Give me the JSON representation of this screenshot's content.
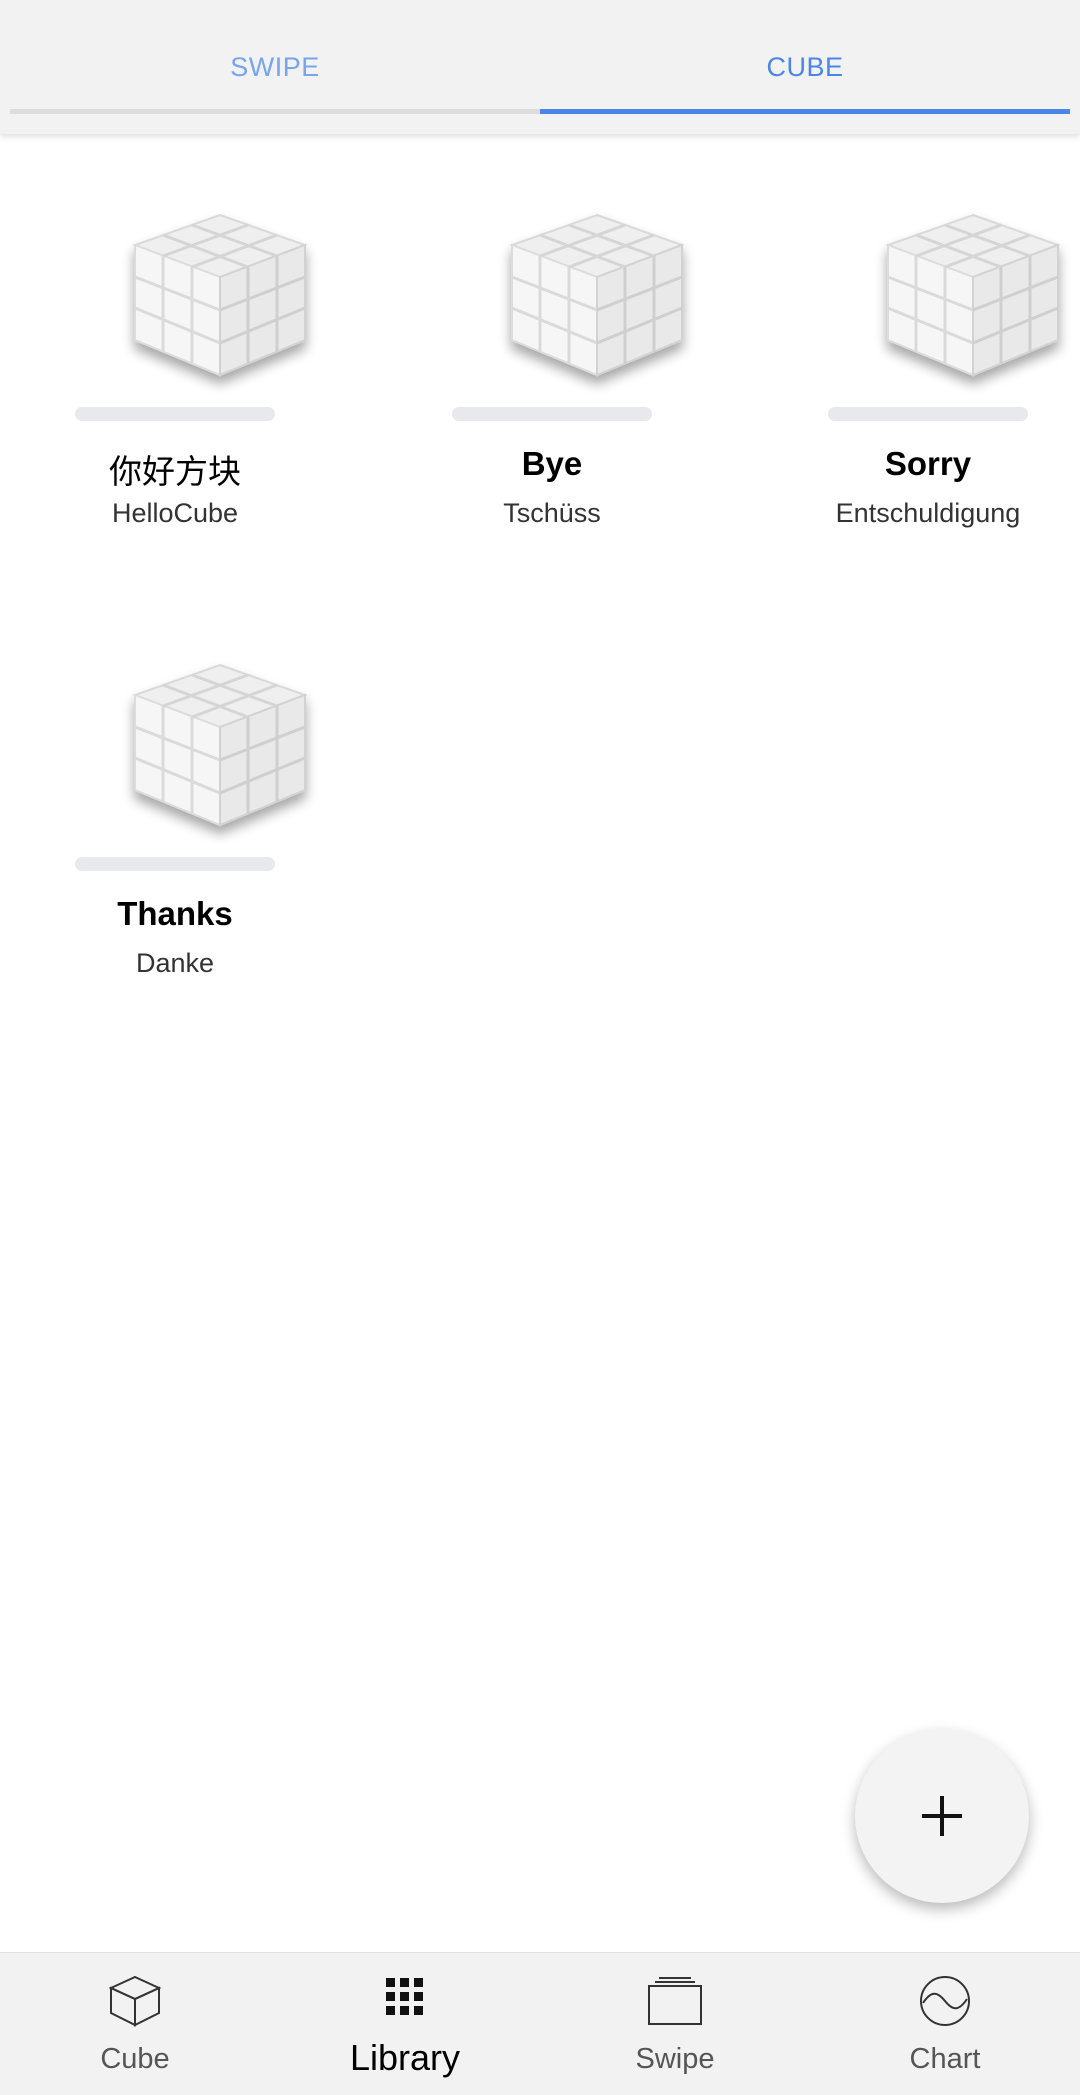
{
  "top_tabs": {
    "items": [
      {
        "label": "SWIPE",
        "active": false
      },
      {
        "label": "CUBE",
        "active": true
      }
    ],
    "active_color": "#4a86e8",
    "inactive_color": "#76a5ee"
  },
  "library": {
    "cards": [
      {
        "title": "你好方块",
        "subtitle": "HelloCube",
        "icon": "cube-icon"
      },
      {
        "title": "Bye",
        "subtitle": "Tschüss",
        "icon": "cube-icon"
      },
      {
        "title": "Sorry",
        "subtitle": "Entschuldigung",
        "icon": "cube-icon"
      },
      {
        "title": "Thanks",
        "subtitle": "Danke",
        "icon": "cube-icon"
      }
    ]
  },
  "fab": {
    "icon": "plus-icon"
  },
  "bottom_nav": {
    "items": [
      {
        "label": "Cube",
        "icon": "cube-outline-icon",
        "active": false
      },
      {
        "label": "Library",
        "icon": "grid-icon",
        "active": true
      },
      {
        "label": "Swipe",
        "icon": "stack-icon",
        "active": false
      },
      {
        "label": "Chart",
        "icon": "wave-circle-icon",
        "active": false
      }
    ]
  }
}
